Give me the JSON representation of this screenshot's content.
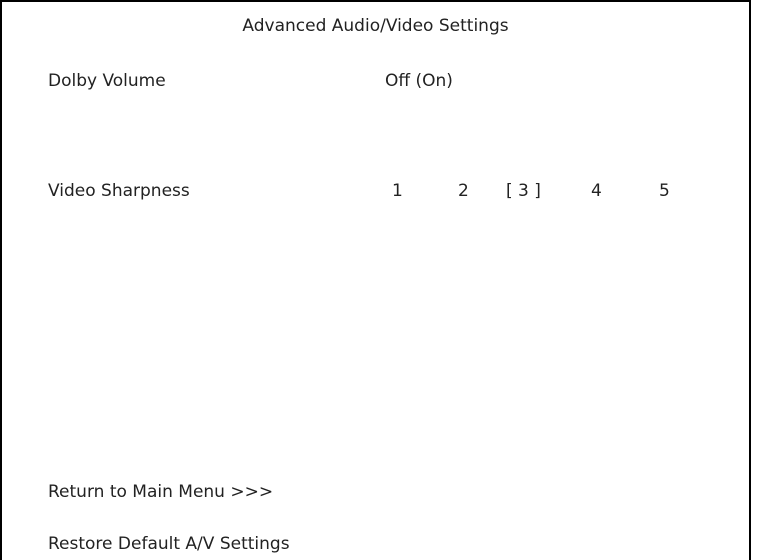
{
  "title": "Advanced Audio/Video Settings",
  "dolby": {
    "label": "Dolby Volume",
    "off": "Off",
    "on": "(On)"
  },
  "sharpness": {
    "label": "Video Sharpness",
    "options": [
      "1",
      "2",
      "[ 3 ]",
      "4",
      "5"
    ],
    "selected": 3
  },
  "actions": {
    "return": "Return to Main Menu >>>",
    "restore": "Restore Default A/V Settings"
  }
}
